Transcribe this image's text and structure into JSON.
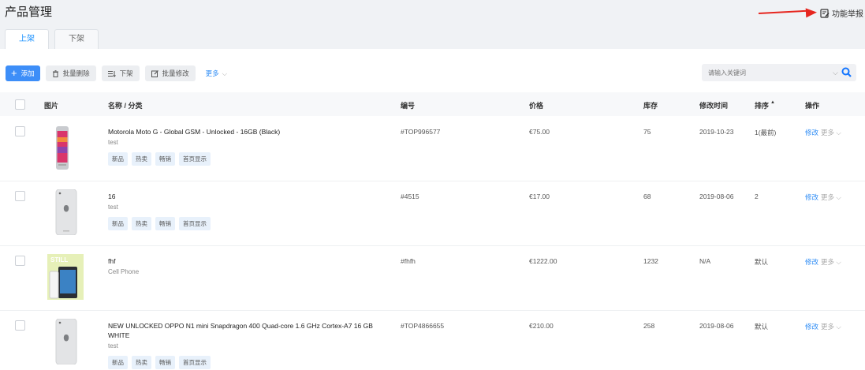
{
  "page": {
    "title": "产品管理",
    "report_label": "功能举报"
  },
  "tabs": [
    {
      "label": "上架"
    },
    {
      "label": "下架"
    }
  ],
  "toolbar": {
    "add_label": "添加",
    "batch_delete_label": "批量删除",
    "offshelf_label": "下架",
    "batch_edit_label": "批量修改",
    "more_label": "更多"
  },
  "search": {
    "placeholder": "请输入关键词"
  },
  "columns": {
    "image": "图片",
    "name": "名称 / 分类",
    "code": "编号",
    "price": "价格",
    "stock": "库存",
    "modified": "修改时间",
    "sort": "排序",
    "sort_arrow": "▲",
    "action": "操作"
  },
  "rows": [
    {
      "name": "Motorola Moto G - Global GSM - Unlocked - 16GB (Black)",
      "category": "test",
      "tags": [
        "新品",
        "热卖",
        "畅销",
        "首页显示"
      ],
      "code": "#TOP996577",
      "price": "€75.00",
      "stock": "75",
      "modified": "2019-10-23",
      "sort": "1(最前)",
      "edit": "修改",
      "more": "更多"
    },
    {
      "name": "16",
      "category": "test",
      "tags": [
        "新品",
        "热卖",
        "畅销",
        "首页显示"
      ],
      "code": "#4515",
      "price": "€17.00",
      "stock": "68",
      "modified": "2019-08-06",
      "sort": "2",
      "edit": "修改",
      "more": "更多"
    },
    {
      "name": "fhf",
      "category": "Cell Phone",
      "tags": [],
      "code": "#fhfh",
      "price": "€1222.00",
      "stock": "1232",
      "modified": "N/A",
      "sort": "默认",
      "edit": "修改",
      "more": "更多",
      "thumb_text": "STILL"
    },
    {
      "name": "NEW UNLOCKED OPPO N1 mini Snapdragon 400 Quad-core 1.6 GHz Cortex-A7 16 GB WHITE",
      "category": "test",
      "tags": [
        "新品",
        "热卖",
        "畅销",
        "首页显示"
      ],
      "code": "#TOP4866655",
      "price": "€210.00",
      "stock": "258",
      "modified": "2019-08-06",
      "sort": "默认",
      "edit": "修改",
      "more": "更多"
    }
  ],
  "colors": {
    "primary": "#3d8ef8",
    "link": "#2e8cf5",
    "arrow": "#e6261f"
  }
}
